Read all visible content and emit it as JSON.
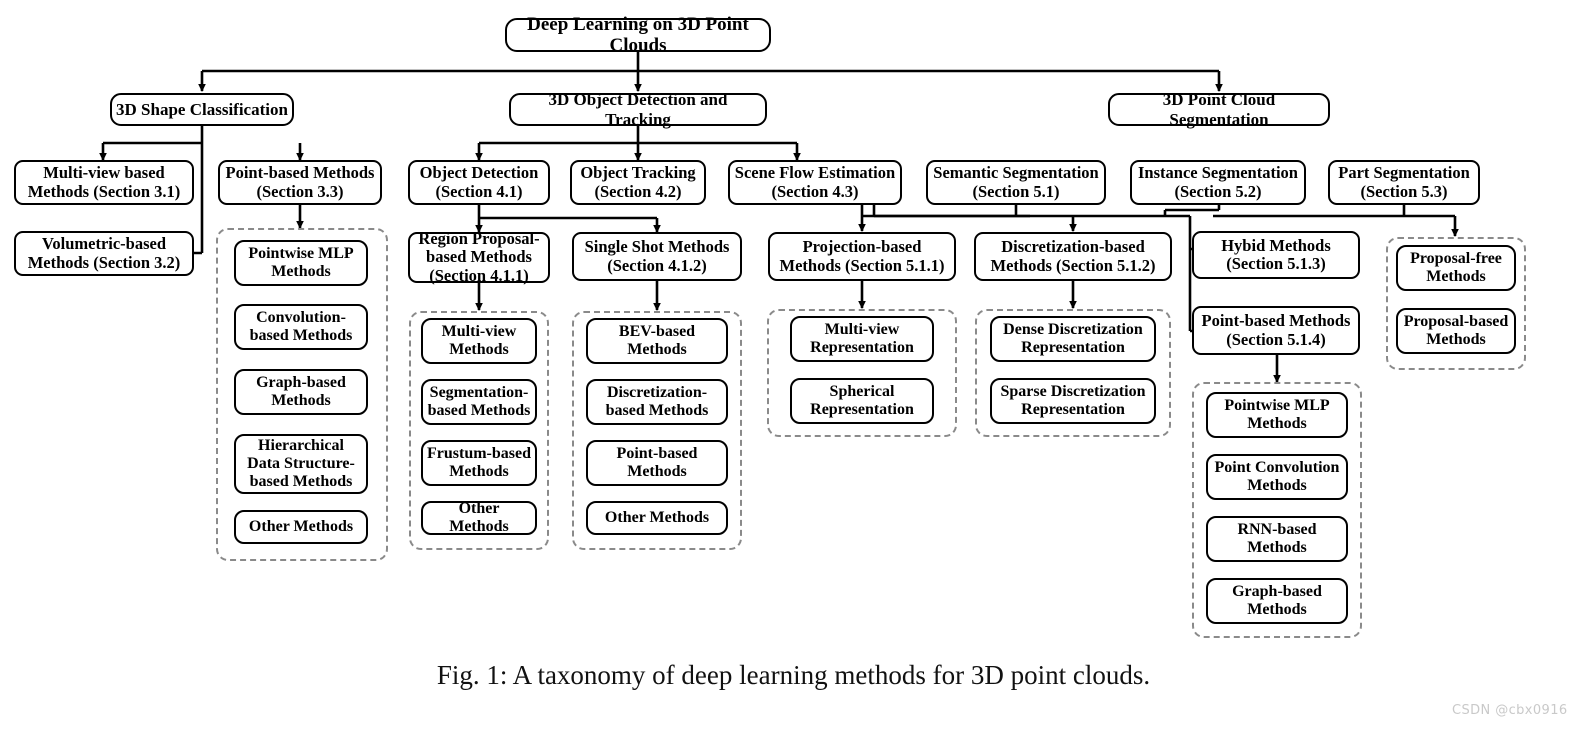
{
  "figure": {
    "caption": "Fig. 1: A taxonomy of deep learning methods for 3D point clouds.",
    "watermark": "CSDN @cbx0916",
    "line_color": "#000000",
    "group_border_color": "#8a8a8a",
    "background": "#ffffff"
  },
  "root": {
    "label": "Deep Learning on 3D Point Clouds"
  },
  "branches": [
    {
      "label": "3D Shape Classification"
    },
    {
      "label": "3D Object Detection and Tracking"
    },
    {
      "label": "3D Point Cloud Segmentation"
    }
  ],
  "classification": {
    "multiview": "Multi-view based Methods (Section 3.1)",
    "volumetric": "Volumetric-based Methods (Section 3.2)",
    "pointbased": "Point-based Methods (Section 3.3)",
    "pointbased_children": [
      "Pointwise MLP Methods",
      "Convolution-based Methods",
      "Graph-based Methods",
      "Hierarchical Data Structure-based Methods",
      "Other Methods"
    ]
  },
  "detection": {
    "object_detection": "Object Detection (Section 4.1)",
    "object_tracking": "Object Tracking (Section 4.2)",
    "scene_flow": "Scene Flow Estimation (Section 4.3)",
    "region_proposal": "Region Proposal-based Methods (Section 4.1.1)",
    "single_shot": "Single Shot Methods (Section 4.1.2)",
    "region_proposal_children": [
      "Multi-view Methods",
      "Segmentation-based Methods",
      "Frustum-based Methods",
      "Other Methods"
    ],
    "single_shot_children": [
      "BEV-based Methods",
      "Discretization-based Methods",
      "Point-based Methods",
      "Other Methods"
    ]
  },
  "segmentation": {
    "semantic": "Semantic Segmentation (Section 5.1)",
    "instance": "Instance Segmentation (Section 5.2)",
    "part": "Part Segmentation (Section 5.3)",
    "projection_based": "Projection-based Methods (Section 5.1.1)",
    "discretization_based": "Discretization-based Methods (Section 5.1.2)",
    "hybid": "Hybid Methods (Section 5.1.3)",
    "point_based": "Point-based Methods (Section 5.1.4)",
    "projection_children": [
      "Multi-view Representation",
      "Spherical Representation"
    ],
    "discretization_children": [
      "Dense Discretization Representation",
      "Sparse Discretization Representation"
    ],
    "point_based_children": [
      "Pointwise MLP Methods",
      "Point Convolution Methods",
      "RNN-based Methods",
      "Graph-based Methods"
    ],
    "part_children": [
      "Proposal-free Methods",
      "Proposal-based Methods"
    ]
  }
}
